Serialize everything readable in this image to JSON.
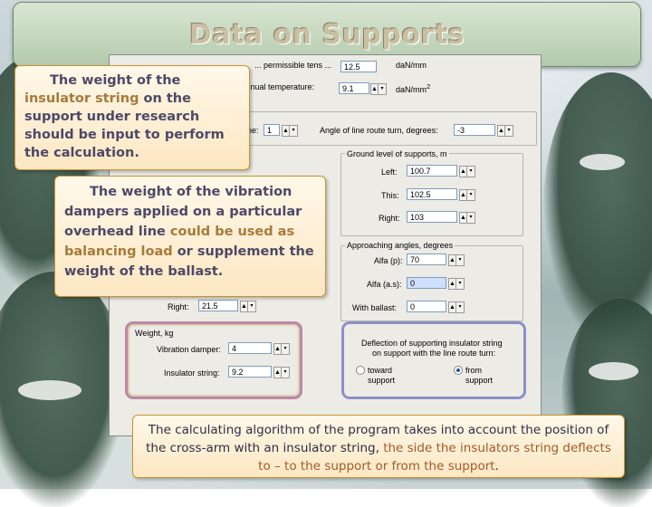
{
  "title": "Data on Supports",
  "form": {
    "permissible_tens_label": "... permissible tens ...",
    "permissible_tens_value": "12.5",
    "permissible_tens_unit": "daN/mm",
    "annual_temp_label": "e annual temperature:",
    "annual_temp_value": "9.1",
    "annual_temp_unit": "daN/mm",
    "annual_temp_sup": "2",
    "count_label": "ne:",
    "count_value": "1",
    "angle_turn_label": "Angle of line route turn, degrees:",
    "angle_turn_value": "-3",
    "ground_level": {
      "title": "Ground level of supports, m",
      "left_label": "Left:",
      "left_value": "100.7",
      "this_label": "This:",
      "this_value": "102.5",
      "right_label": "Right:",
      "right_value": "103"
    },
    "approach_angles": {
      "title": "Approaching angles, degrees",
      "alfa_label": "Alfa (p):",
      "alfa_value": "70",
      "alfa_as_label": "Alfa (a.s):",
      "alfa_as_value": "0",
      "ballast_label": "With ballast:",
      "ballast_value": "0"
    },
    "right_label": "Right:",
    "right_value": "21.5",
    "weight": {
      "title": "Weight, kg",
      "damper_label": "Vibration damper:",
      "damper_value": "4",
      "string_label": "Insulator string:",
      "string_value": "9.2"
    },
    "deflection": {
      "title_line1": "Deflection of supporting insulator string",
      "title_line2": "on support with the line route turn:",
      "opt1_line1": "toward",
      "opt1_line2": "support",
      "opt2_line1": "from",
      "opt2_line2": "support",
      "selected": "from support"
    }
  },
  "callouts": {
    "insulator_p1": "The weight of the",
    "insulator_p2": "insulator string",
    "insulator_p3": " on the support under research should be input to perform the calculation.",
    "damper_p1": "The weight of the vibration dampers applied on a particular overhead line ",
    "damper_p2": "could be used as balancing load",
    "damper_p3": " or supplement the weight of the ballast.",
    "algorithm_p1": "The calculating algorithm of the program takes into account the position of the cross-arm with an insulator string, ",
    "algorithm_p2": "the side the insulators string deflects to – to the support or from the support",
    "algorithm_p3": "."
  }
}
